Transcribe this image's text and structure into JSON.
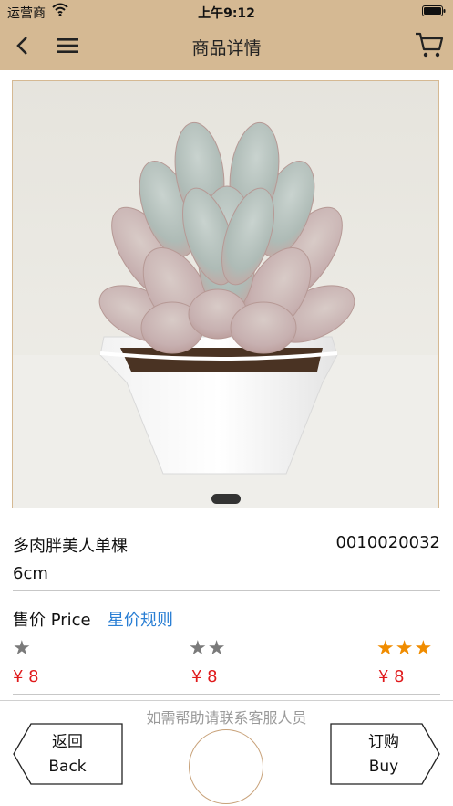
{
  "status_bar": {
    "carrier": "运营商",
    "time": "上午9:12"
  },
  "nav": {
    "title": "商品详情",
    "icons": [
      "back-icon",
      "menu-icon",
      "cart-icon"
    ]
  },
  "product": {
    "name": "多肉胖美人单棵",
    "code": "0010020032",
    "size": "6cm",
    "price_label": "售价 Price",
    "price_rule_link": "星价规则",
    "tiers": [
      {
        "stars": "★",
        "price": "¥ 8"
      },
      {
        "stars": "★★",
        "price": "¥ 8"
      },
      {
        "stars": "★★★",
        "price": "¥ 8"
      }
    ]
  },
  "footer": {
    "help_text": "如需帮助请联系客服人员",
    "back_cn": "返回",
    "back_en": "Back",
    "buy_cn": "订购",
    "buy_en": "Buy"
  },
  "colors": {
    "header_bg": "#d5b993",
    "link": "#2a7fd4",
    "price": "#e0191b",
    "star_gray": "#7a7a7a",
    "star_orange": "#f08c00"
  }
}
